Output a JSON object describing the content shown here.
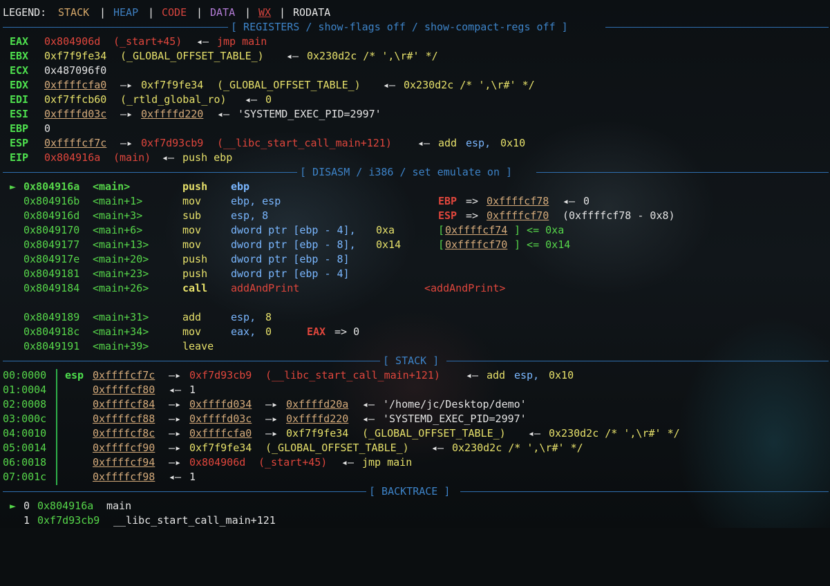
{
  "legend": {
    "prefix": "LEGEND:",
    "stack": "STACK",
    "sep": "|",
    "heap": "HEAP",
    "code": "CODE",
    "data": "DATA",
    "wx": "WX",
    "rodata": "RODATA"
  },
  "headers": {
    "registers": "[ REGISTERS / show-flags off / show-compact-regs off ]",
    "disasm": "[ DISASM / i386 / set emulate on ]",
    "stack": "[ STACK ]",
    "backtrace": "[ BACKTRACE ]"
  },
  "registers": [
    {
      "name": "EAX",
      "value": "0x804906d",
      "extra": " (_start+45) ◂— jmp main"
    },
    {
      "name": "EBX",
      "value": "0xf7f9fe34",
      "extra": " (_GLOBAL_OFFSET_TABLE_) ◂— 0x230d2c /* ',\\r#' */"
    },
    {
      "name": "ECX",
      "value": "0x487096f0",
      "extra": ""
    },
    {
      "name": "EDX",
      "value": "0xffffcfa0",
      "extra": " —▸ 0xf7f9fe34 (_GLOBAL_OFFSET_TABLE_) ◂— 0x230d2c /* ',\\r#' */"
    },
    {
      "name": "EDI",
      "value": "0xf7ffcb60",
      "extra": " (_rtld_global_ro) ◂— 0"
    },
    {
      "name": "ESI",
      "value": "0xffffd03c",
      "extra": " —▸ 0xffffd220 ◂— 'SYSTEMD_EXEC_PID=2997'"
    },
    {
      "name": "EBP",
      "value": "0",
      "extra": ""
    },
    {
      "name": "ESP",
      "value": "0xffffcf7c",
      "extra": " —▸ 0xf7d93cb9 (__libc_start_call_main+121) ◂— add esp, 0x10"
    },
    {
      "name": "EIP",
      "value": "0x804916a",
      "extra": " (main) ◂— push ebp"
    }
  ],
  "reg_parts": {
    "eax_sym": "(_start+45)",
    "eax_arrow": "◂—",
    "eax_ins": "jmp main",
    "ebx_sym": "(_GLOBAL_OFFSET_TABLE_)",
    "ebx_arrow": "◂—",
    "ebx_val": "0x230d2c /* ',\\r#' */",
    "edx_arrow": "—▸",
    "edx_ptr": "0xf7f9fe34",
    "edx_sym": "(_GLOBAL_OFFSET_TABLE_)",
    "edx_arrow2": "◂—",
    "edx_val": "0x230d2c /* ',\\r#' */",
    "edi_sym": "(_rtld_global_ro)",
    "edi_arrow": "◂—",
    "edi_val": "0",
    "esi_arrow": "—▸",
    "esi_ptr": "0xffffd220",
    "esi_arrow2": "◂—",
    "esi_val": "'SYSTEMD_EXEC_PID=2997'",
    "esp_arrow": "—▸",
    "esp_ptr": "0xf7d93cb9",
    "esp_sym": "(__libc_start_call_main+121)",
    "esp_arrow2": "◂—",
    "esp_ins1": "add",
    "esp_ins2": "esp,",
    "esp_ins3": "0x10",
    "eip_sym": "(main)",
    "eip_arrow": "◂—",
    "eip_ins": "push ebp"
  },
  "disasm": [
    {
      "marker": "►",
      "addr": "0x804916a",
      "sym": "<main>",
      "mn": "push",
      "ops": "ebp",
      "note": ""
    },
    {
      "marker": "",
      "addr": "0x804916b",
      "sym": "<main+1>",
      "mn": "mov",
      "ops": "ebp, esp",
      "note": "EBP => 0xffffcf78 ◂— 0"
    },
    {
      "marker": "",
      "addr": "0x804916d",
      "sym": "<main+3>",
      "mn": "sub",
      "ops": "esp, 8",
      "note": "ESP => 0xffffcf70 (0xffffcf78 - 0x8)"
    },
    {
      "marker": "",
      "addr": "0x8049170",
      "sym": "<main+6>",
      "mn": "mov",
      "ops": "dword ptr [ebp - 4], 0xa",
      "note": "[0xffffcf74] <= 0xa"
    },
    {
      "marker": "",
      "addr": "0x8049177",
      "sym": "<main+13>",
      "mn": "mov",
      "ops": "dword ptr [ebp - 8], 0x14",
      "note": "[0xffffcf70] <= 0x14"
    },
    {
      "marker": "",
      "addr": "0x804917e",
      "sym": "<main+20>",
      "mn": "push",
      "ops": "dword ptr [ebp - 8]",
      "note": ""
    },
    {
      "marker": "",
      "addr": "0x8049181",
      "sym": "<main+23>",
      "mn": "push",
      "ops": "dword ptr [ebp - 4]",
      "note": ""
    },
    {
      "marker": "",
      "addr": "0x8049184",
      "sym": "<main+26>",
      "mn": "call",
      "ops": "addAndPrint",
      "note": "<addAndPrint>"
    },
    {
      "marker": "",
      "addr": "0x8049189",
      "sym": "<main+31>",
      "mn": "add",
      "ops": "esp, 8",
      "note": ""
    },
    {
      "marker": "",
      "addr": "0x804918c",
      "sym": "<main+34>",
      "mn": "mov",
      "ops": "eax, 0",
      "note": "EAX => 0"
    },
    {
      "marker": "",
      "addr": "0x8049191",
      "sym": "<main+39>",
      "mn": "leave",
      "ops": "",
      "note": ""
    }
  ],
  "disasm_parts": {
    "ebp_lbl": "EBP",
    "ebp_op": "=>",
    "ebp_addr": "0xffffcf78",
    "ebp_arrow": "◂—",
    "ebp_val": "0",
    "esp_lbl": "ESP",
    "esp_op": "=>",
    "esp_addr": "0xffffcf70",
    "esp_val": "(0xffffcf78 - 0x8)",
    "m1_open": "[",
    "m1_addr": "0xffffcf74",
    "m1_rest": "] <= 0xa",
    "m2_open": "[",
    "m2_addr": "0xffffcf70",
    "m2_rest": "] <= 0x14",
    "eax_lbl": "EAX",
    "eax_rest": "=> 0",
    "ops_a1": "ebp, esp",
    "ops_a2": "esp, 8",
    "ops_a3a": "dword ptr [ebp - 4], ",
    "ops_a3b": "0xa",
    "ops_a4a": "dword ptr [ebp - 8], ",
    "ops_a4b": "0x14",
    "ops_a5": "dword ptr [ebp - 8]",
    "ops_a6": "dword ptr [ebp - 4]",
    "ops_a7a": "esp, ",
    "ops_a7b": "8",
    "ops_a8a": "eax, ",
    "ops_a8b": "0"
  },
  "stack": [
    {
      "idx": "00:0000",
      "reg": "esp",
      "a": "0xffffcf7c",
      "rest": "—▸ 0xf7d93cb9 (__libc_start_call_main+121) ◂— add esp, 0x10"
    },
    {
      "idx": "01:0004",
      "reg": "",
      "a": "0xffffcf80",
      "rest": "◂— 1"
    },
    {
      "idx": "02:0008",
      "reg": "",
      "a": "0xffffcf84",
      "rest": "—▸ 0xffffd034 —▸ 0xffffd20a ◂— '/home/jc/Desktop/demo'"
    },
    {
      "idx": "03:000c",
      "reg": "",
      "a": "0xffffcf88",
      "rest": "—▸ 0xffffd03c —▸ 0xffffd220 ◂— 'SYSTEMD_EXEC_PID=2997'"
    },
    {
      "idx": "04:0010",
      "reg": "",
      "a": "0xffffcf8c",
      "rest": "—▸ 0xffffcfa0 —▸ 0xf7f9fe34 (_GLOBAL_OFFSET_TABLE_) ◂— 0x230d2c /* ',\\r#' */"
    },
    {
      "idx": "05:0014",
      "reg": "",
      "a": "0xffffcf90",
      "rest": "—▸ 0xf7f9fe34 (_GLOBAL_OFFSET_TABLE_) ◂— 0x230d2c /* ',\\r#' */"
    },
    {
      "idx": "06:0018",
      "reg": "",
      "a": "0xffffcf94",
      "rest": "—▸ 0x804906d (_start+45) ◂— jmp main"
    },
    {
      "idx": "07:001c",
      "reg": "",
      "a": "0xffffcf98",
      "rest": "◂— 1"
    }
  ],
  "stack_parts": {
    "s0_arrow": "—▸",
    "s0_ptr": "0xf7d93cb9",
    "s0_sym": "(__libc_start_call_main+121)",
    "s0_arrow2": "◂—",
    "s0_i1": "add",
    "s0_i2": "esp,",
    "s0_i3": "0x10",
    "s1_arrow": "◂—",
    "s1_val": "1",
    "s2_arrow": "—▸",
    "s2_p1": "0xffffd034",
    "s2_arrow2": "—▸",
    "s2_p2": "0xffffd20a",
    "s2_arrow3": "◂—",
    "s2_val": "'/home/jc/Desktop/demo'",
    "s3_arrow": "—▸",
    "s3_p1": "0xffffd03c",
    "s3_arrow2": "—▸",
    "s3_p2": "0xffffd220",
    "s3_arrow3": "◂—",
    "s3_val": "'SYSTEMD_EXEC_PID=2997'",
    "s4_arrow": "—▸",
    "s4_p1": "0xffffcfa0",
    "s4_arrow2": "—▸",
    "s4_p2": "0xf7f9fe34",
    "s4_sym": "(_GLOBAL_OFFSET_TABLE_)",
    "s4_arrow3": "◂—",
    "s4_val": "0x230d2c /* ',\\r#' */",
    "s5_arrow": "—▸",
    "s5_p1": "0xf7f9fe34",
    "s5_sym": "(_GLOBAL_OFFSET_TABLE_)",
    "s5_arrow2": "◂—",
    "s5_val": "0x230d2c /* ',\\r#' */",
    "s6_arrow": "—▸",
    "s6_p1": "0x804906d",
    "s6_sym": "(_start+45)",
    "s6_arrow2": "◂—",
    "s6_ins": "jmp main",
    "s7_arrow": "◂—",
    "s7_val": "1"
  },
  "backtrace": [
    {
      "marker": "►",
      "n": "0",
      "addr": "0x804916a",
      "sym": "main"
    },
    {
      "marker": "",
      "n": "1",
      "addr": "0xf7d93cb9",
      "sym": "__libc_start_call_main+121"
    }
  ],
  "colors": {
    "register_name": "#4ee04e",
    "code_red": "#e0463c",
    "stack_orange": "#d6a86a",
    "heap_blue": "#3e7fc1",
    "data_purple": "#b37cd6",
    "header_rule": "#2f6fb0",
    "stack_bar": "#2fb14a"
  }
}
